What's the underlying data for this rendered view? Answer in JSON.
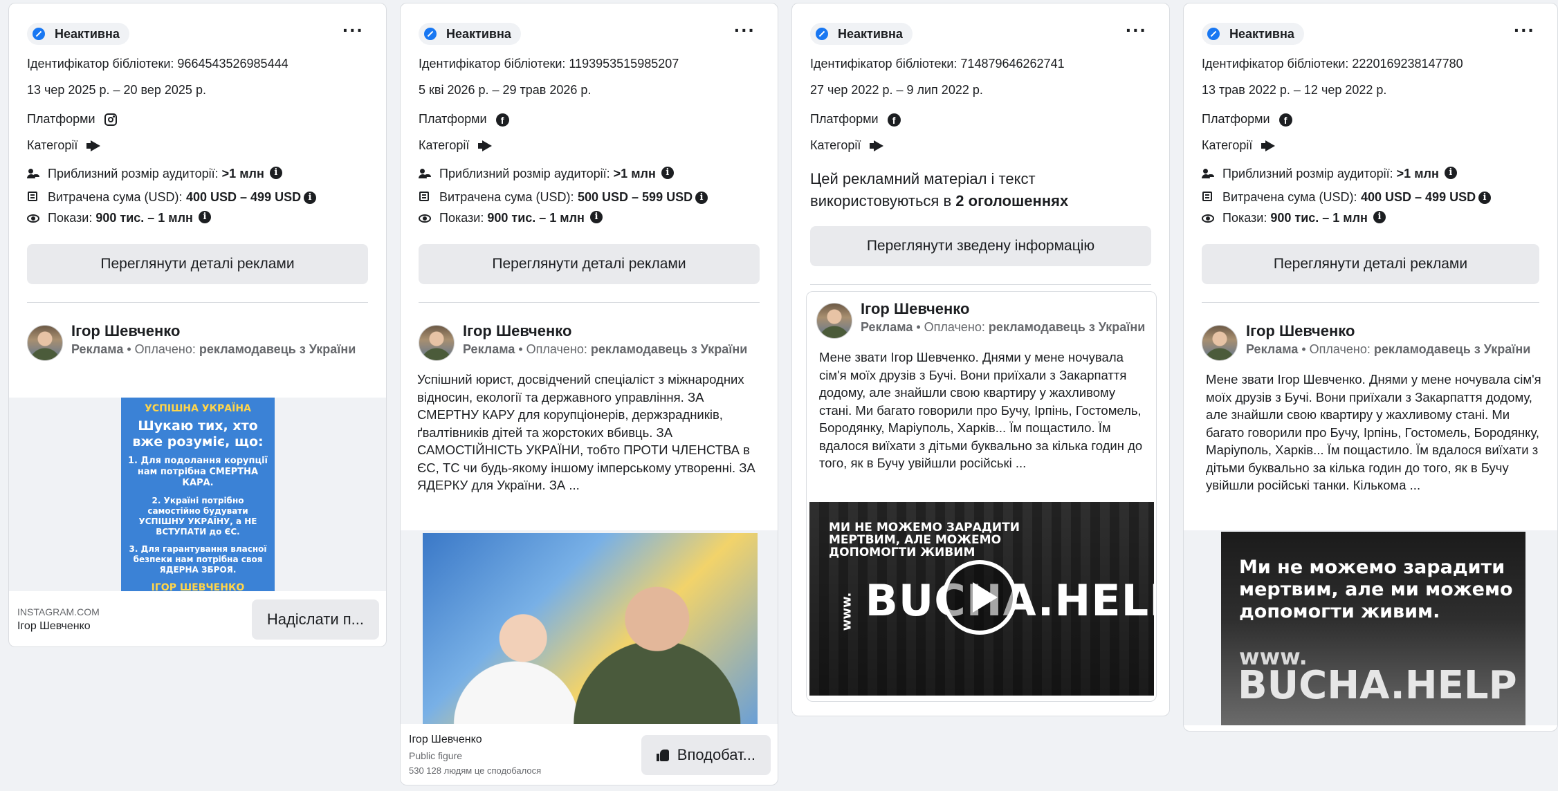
{
  "cards": [
    {
      "status": "Неактивна",
      "library_id": "Ідентифікатор бібліотеки: 9664543526985444",
      "dates": "13 чер 2025 р. – 20 вер 2025 р.",
      "platforms_label": "Платформи",
      "platform_icon": "instagram-icon",
      "categories_label": "Категорії",
      "audience_label": "Приблизний розмір аудиторії:",
      "audience_value": ">1 млн",
      "spend_label": "Витрачена сума (USD):",
      "spend_value": "400 USD – 499 USD",
      "impressions_label": "Покази:",
      "impressions_value": "900 тис. – 1 млн",
      "button": "Переглянути деталі реклами",
      "advertiser": "Ігор Шевченко",
      "sponsored": "Реклама",
      "paid_label": "• Оплачено:",
      "paid_by": "рекламодавець з України",
      "creative": {
        "title": "УСПІШНА УКРАЇНА",
        "lead": "Шукаю тих, хто вже розуміє, що:",
        "p1": "1. Для подолання корупції нам потрібна СМЕРТНА КАРА.",
        "p2": "2. Україні потрібно самостійно будувати УСПІШНУ УКРАЇНУ, а НЕ ВСТУПАТИ до ЄС.",
        "p3": "3. Для гарантування власної безпеки нам потрібна своя ЯДЕРНА ЗБРОЯ.",
        "sign": "ІГОР ШЕВЧЕНКО"
      },
      "footer_domain": "INSTAGRAM.COM",
      "footer_name": "Ігор Шевченко",
      "footer_button": "Надіслати п..."
    },
    {
      "status": "Неактивна",
      "library_id": "Ідентифікатор бібліотеки: 1193953515985207",
      "dates": "5 кві 2026 р. – 29 трав 2026 р.",
      "platforms_label": "Платформи",
      "platform_icon": "facebook-icon",
      "categories_label": "Категорії",
      "audience_label": "Приблизний розмір аудиторії:",
      "audience_value": ">1 млн",
      "spend_label": "Витрачена сума (USD):",
      "spend_value": "500 USD – 599 USD",
      "impressions_label": "Покази:",
      "impressions_value": "900 тис. – 1 млн",
      "button": "Переглянути деталі реклами",
      "advertiser": "Ігор Шевченко",
      "sponsored": "Реклама",
      "paid_label": "• Оплачено:",
      "paid_by": "рекламодавець з України",
      "ad_text": "Успішний юрист, досвідчений спеціаліст з міжнародних відносин, екології та державного управління. ЗА СМЕРТНУ КАРУ для корупціонерів, держзрадників, ґвалтівників дітей та жорстоких вбивць. ЗА САМОСТІЙНІСТЬ УКРАЇНИ, тобто ПРОТИ ЧЛЕНСТВА в ЄС, ТС чи будь-якому іншому імперському утворенні. ЗА ЯДЕРКУ для України. ЗА ...",
      "footer_name": "Ігор Шевченко",
      "footer_category": "Public figure",
      "footer_likes": "530 128 людям це сподобалося",
      "footer_button": "Вподобат..."
    },
    {
      "status": "Неактивна",
      "library_id": "Ідентифікатор бібліотеки: 714879646262741",
      "dates": "27 чер 2022 р. – 9 лип 2022 р.",
      "platforms_label": "Платформи",
      "platform_icon": "facebook-icon",
      "categories_label": "Категорії",
      "summary_pre": "Цей рекламний матеріал і текст використовуються в",
      "summary_count": "2 оголошеннях",
      "button": "Переглянути зведену інформацію",
      "advertiser": "Ігор Шевченко",
      "sponsored": "Реклама",
      "paid_label": "• Оплачено:",
      "paid_by": "рекламодавець з України",
      "ad_text": "Мене звати Ігор Шевченко. Днями у мене ночувала сім'я моїх друзів з Бучі. Вони приїхали з Закарпаття додому, але знайшли свою квартиру у жахливому стані. Ми багато говорили про Бучу, Ірпінь, Гостомель, Бородянку, Маріуполь, Харків... Їм пощастило. Їм вдалося виїхати з дітьми буквально за кілька годин до того, як в Бучу увійшли російські ...",
      "video_caption": "МИ НЕ МОЖЕМО ЗАРАДИТИ МЕРТВИМ, АЛЕ МОЖЕМО ДОПОМОГТИ ЖИВИМ",
      "video_brand_prefix": "www.",
      "video_brand": "BUCHA.HELP"
    },
    {
      "status": "Неактивна",
      "library_id": "Ідентифікатор бібліотеки: 2220169238147780",
      "dates": "13 трав 2022 р. – 12 чер 2022 р.",
      "platforms_label": "Платформи",
      "platform_icon": "facebook-icon",
      "categories_label": "Категорії",
      "audience_label": "Приблизний розмір аудиторії:",
      "audience_value": ">1 млн",
      "spend_label": "Витрачена сума (USD):",
      "spend_value": "400 USD – 499 USD",
      "impressions_label": "Покази:",
      "impressions_value": "900 тис. – 1 млн",
      "button": "Переглянути деталі реклами",
      "advertiser": "Ігор Шевченко",
      "sponsored": "Реклама",
      "paid_label": "• Оплачено:",
      "paid_by": "рекламодавець з України",
      "ad_text": "Мене звати Ігор Шевченко. Днями у мене ночувала сім'я моїх друзів з Бучі. Вони приїхали з Закарпаття додому, але знайшли свою квартиру у жахливому стані. Ми багато говорили про Бучу, Ірпінь, Гостомель, Бородянку, Маріуполь, Харків... Їм пощастило. Їм вдалося виїхати з дітьми буквально за кілька годин до того, як в Бучу увійшли російські танки. Кількома ...",
      "image_caption": "Ми не можемо зарадити мертвим, але ми можемо допомогти живим.",
      "image_brand_prefix": "www.",
      "image_brand": "BUCHA.HELP"
    }
  ],
  "colors": {
    "page_bg": "#f0f2f5",
    "status_blue": "#1877f2",
    "button_bg": "#e9eaed",
    "secondary_text": "#65676b"
  }
}
